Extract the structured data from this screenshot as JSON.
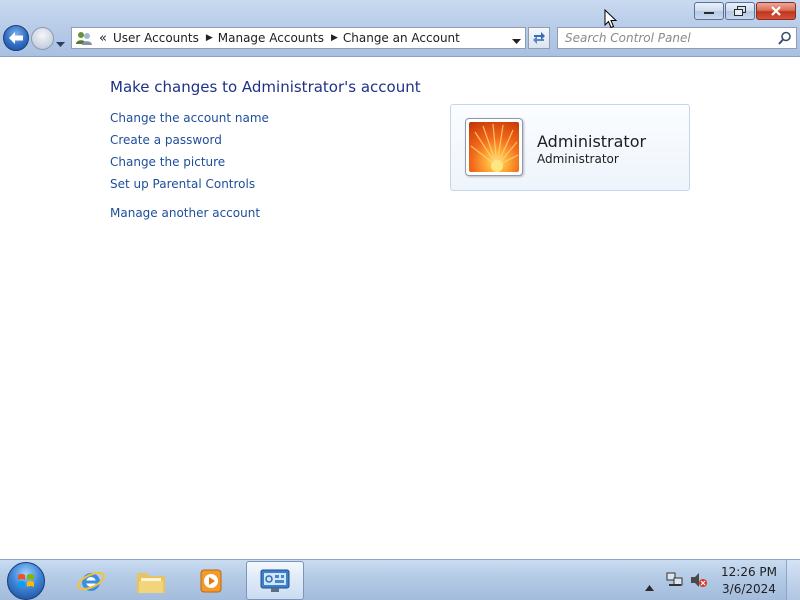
{
  "window": {
    "minimize_icon": "minimize-icon",
    "restore_icon": "restore-icon",
    "close_icon": "close-icon"
  },
  "navigation": {
    "back_icon": "back-arrow-icon",
    "forward_icon": "forward-arrow-icon",
    "recent_pages_icon": "chevron-down-icon"
  },
  "address_bar": {
    "overflow": "«",
    "breadcrumbs": [
      "User Accounts",
      "Manage Accounts",
      "Change an Account"
    ],
    "separator_icon": "triangle-right-icon"
  },
  "search": {
    "placeholder": "Search Control Panel"
  },
  "main": {
    "title": "Make changes to Administrator's account",
    "tasks": [
      "Change the account name",
      "Create a password",
      "Change the picture",
      "Set up Parental Controls"
    ],
    "secondary_task": "Manage another account"
  },
  "account": {
    "name": "Administrator",
    "type": "Administrator",
    "picture": "orange-flower-picture"
  },
  "taskbar": {
    "items": [
      "start-button",
      "internet-explorer",
      "windows-explorer",
      "windows-media-player",
      "control-panel"
    ],
    "active_item": "control-panel"
  },
  "tray": {
    "time": "12:26 PM",
    "date": "3/6/2024"
  },
  "colors": {
    "link": "#1e4e9a",
    "title": "#1e3287",
    "chrome": "#b9cde9",
    "close_button": "#c0351c"
  }
}
